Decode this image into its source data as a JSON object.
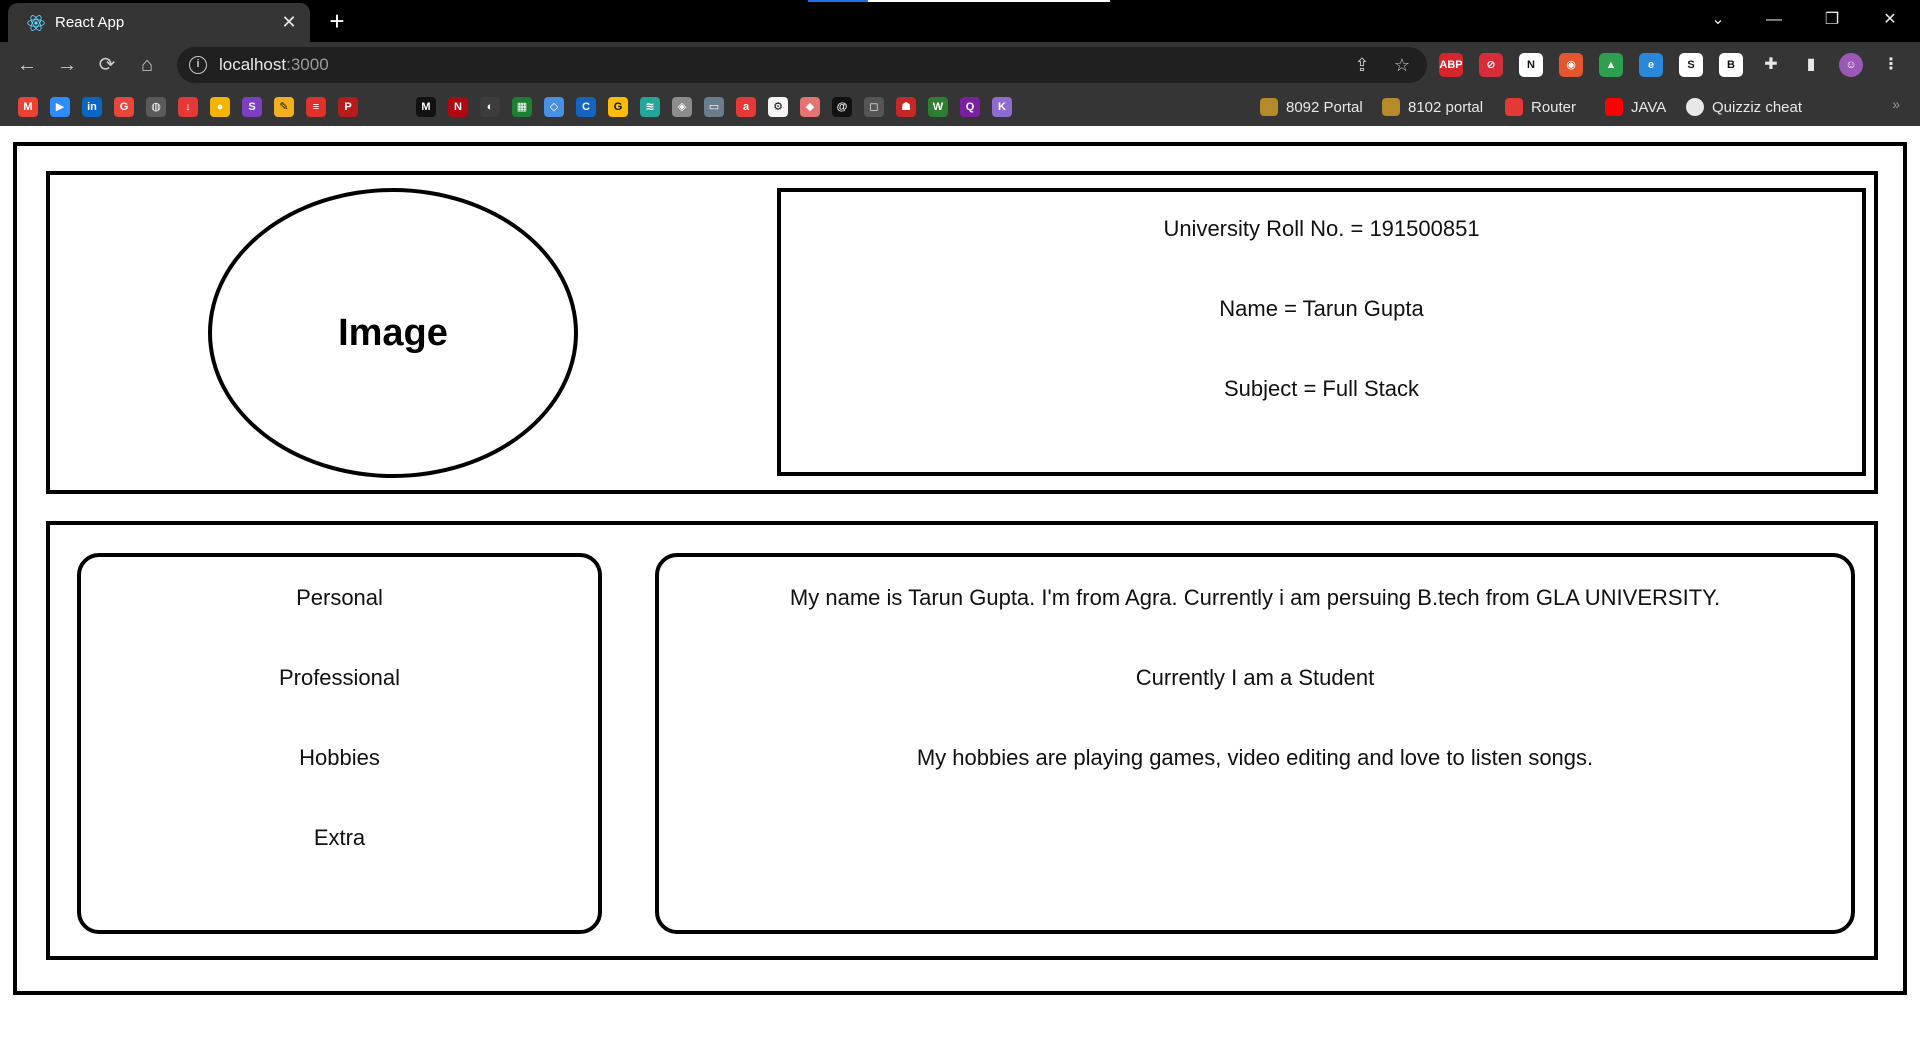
{
  "browser": {
    "tab": {
      "title": "React App",
      "close_glyph": "✕"
    },
    "new_tab_glyph": "+",
    "window_controls": {
      "tab_search": "⌄",
      "minimize": "—",
      "restore": "❐",
      "close": "✕"
    },
    "nav": {
      "back": "←",
      "forward": "→",
      "reload": "⟳",
      "home": "⌂"
    },
    "omnibox": {
      "host": "localhost",
      "port": ":3000",
      "info_glyph": "i"
    },
    "omnibox_actions": {
      "share": "⇪",
      "star": "☆"
    },
    "extensions": [
      {
        "name": "adblock-plus-icon",
        "label": "ABP",
        "color": "#d6252c"
      },
      {
        "name": "opera-block-icon",
        "label": "⊘",
        "color": "#d62d3a"
      },
      {
        "name": "notion-icon",
        "label": "N",
        "color": "#ffffff"
      },
      {
        "name": "chrome-color-icon",
        "label": "◉",
        "color": "#e4572e"
      },
      {
        "name": "drive-icon",
        "label": "▲",
        "color": "#2e9e4f"
      },
      {
        "name": "edge-icon",
        "label": "e",
        "color": "#2b88d8"
      },
      {
        "name": "s-extension-icon",
        "label": "S",
        "color": "#ffffff"
      },
      {
        "name": "b-extension-icon",
        "label": "B",
        "color": "#ffffff"
      },
      {
        "name": "puzzle-extensions-icon",
        "label": "✚",
        "color": "#353535"
      },
      {
        "name": "side-panel-icon",
        "label": "▮",
        "color": "#353535"
      },
      {
        "name": "profile-avatar-icon",
        "label": "☺",
        "color": "#9b59b6"
      },
      {
        "name": "menu-kebab-icon",
        "label": "⋮",
        "color": "#353535"
      }
    ],
    "bookmark_icons": [
      {
        "name": "gmail-icon",
        "label": "M",
        "color": "#ea4335"
      },
      {
        "name": "zoom-icon",
        "label": "▶",
        "color": "#2d8cff"
      },
      {
        "name": "linkedin-icon",
        "label": "in",
        "color": "#0a66c2"
      },
      {
        "name": "google-apps-icon",
        "label": "G",
        "color": "#e8453c"
      },
      {
        "name": "globe-icon",
        "label": "◍",
        "color": "#5a5a5a"
      },
      {
        "name": "download-icon",
        "label": "↓",
        "color": "#e53935"
      },
      {
        "name": "dots-icon",
        "label": "●",
        "color": "#f4b400"
      },
      {
        "name": "s-purple-icon",
        "label": "S",
        "color": "#7b3fbf"
      },
      {
        "name": "paint-icon",
        "label": "✎",
        "color": "#f2b01e"
      },
      {
        "name": "stack-red-icon",
        "label": "≡",
        "color": "#e0312b"
      },
      {
        "name": "p-logo-icon",
        "label": "P",
        "color": "#b71c1c"
      },
      {
        "name": "medium-icon",
        "label": "M",
        "color": "#111111"
      },
      {
        "name": "netflix-icon",
        "label": "N",
        "color": "#b00710"
      },
      {
        "name": "game-icon",
        "label": "◐",
        "color": "#3c3c3c"
      },
      {
        "name": "sheet-icon",
        "label": "▦",
        "color": "#1e7e34"
      },
      {
        "name": "diamond-icon",
        "label": "◇",
        "color": "#4a90e2"
      },
      {
        "name": "c-icon",
        "label": "C",
        "color": "#1565c0"
      },
      {
        "name": "google-icon",
        "label": "G",
        "color": "#fbbc05"
      },
      {
        "name": "lines-icon",
        "label": "≋",
        "color": "#26a69a"
      },
      {
        "name": "layers-icon",
        "label": "◈",
        "color": "#8c8c8c"
      },
      {
        "name": "tv-icon",
        "label": "▭",
        "color": "#6b7d8c"
      },
      {
        "name": "ak-icon",
        "label": "a",
        "color": "#e53935"
      },
      {
        "name": "gear-box-icon",
        "label": "⚙",
        "color": "#f5f5f5"
      },
      {
        "name": "tag-icon",
        "label": "◆",
        "color": "#e57373"
      },
      {
        "name": "spiral-icon",
        "label": "@",
        "color": "#111111"
      },
      {
        "name": "cube-icon",
        "label": "◻",
        "color": "#555555"
      },
      {
        "name": "char-icon",
        "label": "☗",
        "color": "#c62828"
      },
      {
        "name": "w-icon",
        "label": "W",
        "color": "#2e7d32"
      },
      {
        "name": "q-icon",
        "label": "Q",
        "color": "#7b1fa2"
      },
      {
        "name": "k-icon",
        "label": "K",
        "color": "#8e6ccf"
      }
    ],
    "bookmarks_named": [
      {
        "name": "bookmark-8092-portal",
        "label": "8092 Portal",
        "color": "#b58b2a"
      },
      {
        "name": "bookmark-8102-portal",
        "label": "8102 portal",
        "color": "#b58b2a"
      },
      {
        "name": "bookmark-router",
        "label": "Router",
        "color": "#e53935"
      },
      {
        "name": "bookmark-java",
        "label": "JAVA",
        "color": "#ff0000"
      },
      {
        "name": "bookmark-quizziz-cheat",
        "label": "Quizziz cheat",
        "color": "#e8e8e8"
      }
    ],
    "bookmarks_more_glyph": "»"
  },
  "profile": {
    "image_label": "Image",
    "roll": "University Roll No. = 191500851",
    "name": "Name = Tarun Gupta",
    "subject": "Subject = Full Stack"
  },
  "menu": [
    "Personal",
    "Professional",
    "Hobbies",
    "Extra"
  ],
  "details": [
    "My name is Tarun Gupta. I'm from Agra. Currently i am persuing B.tech from GLA UNIVERSITY.",
    "Currently I am a Student",
    "My hobbies are playing games, video editing and love to listen songs."
  ]
}
